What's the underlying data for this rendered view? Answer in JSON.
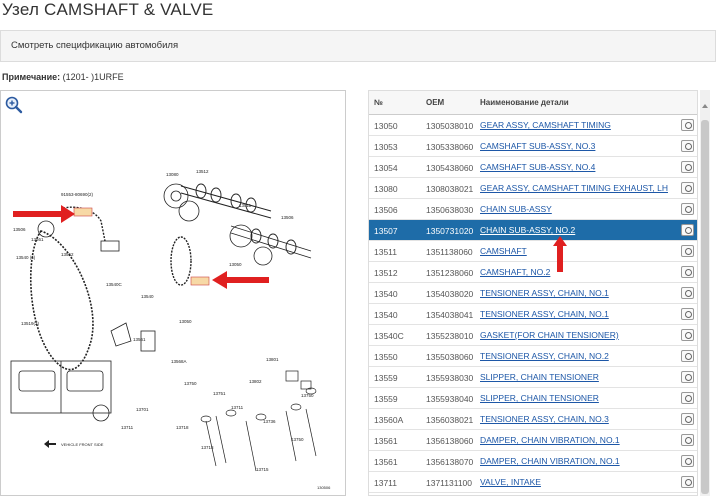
{
  "page": {
    "title": "Узел CAMSHAFT & VALVE"
  },
  "spec_bar": {
    "label": "Смотреть спецификацию автомобиля"
  },
  "note": {
    "label": "Примечание:",
    "value": "(1201- )1URFE"
  },
  "diagram": {
    "callouts": [
      "13523",
      "13521",
      "13540",
      "13506",
      "13561",
      "13050",
      "13053",
      "13054",
      "13080",
      "13507",
      "13508",
      "13509",
      "13559",
      "13565",
      "13566",
      "13511",
      "13512",
      "13750",
      "13751",
      "13711",
      "13715",
      "13731",
      "13736",
      "13701",
      "13802",
      "13801",
      "13560A"
    ],
    "footer_code": "130506"
  },
  "table": {
    "headers": {
      "num": "№",
      "oem": "OEM",
      "name": "Наименование детали"
    },
    "rows": [
      {
        "num": "13050",
        "oem": "1305038010",
        "name": "GEAR ASSY, CAMSHAFT TIMING",
        "selected": false
      },
      {
        "num": "13053",
        "oem": "1305338060",
        "name": "CAMSHAFT SUB-ASSY, NO.3",
        "selected": false
      },
      {
        "num": "13054",
        "oem": "1305438060",
        "name": "CAMSHAFT SUB-ASSY, NO.4",
        "selected": false
      },
      {
        "num": "13080",
        "oem": "1308038021",
        "name": "GEAR ASSY, CAMSHAFT TIMING EXHAUST, LH",
        "selected": false
      },
      {
        "num": "13506",
        "oem": "1350638030",
        "name": "CHAIN SUB-ASSY",
        "selected": false
      },
      {
        "num": "13507",
        "oem": "1350731020",
        "name": "CHAIN SUB-ASSY, NO.2",
        "selected": true
      },
      {
        "num": "13511",
        "oem": "1351138060",
        "name": "CAMSHAFT",
        "selected": false
      },
      {
        "num": "13512",
        "oem": "1351238060",
        "name": "CAMSHAFT, NO.2",
        "selected": false
      },
      {
        "num": "13540",
        "oem": "1354038020",
        "name": "TENSIONER ASSY, CHAIN, NO.1",
        "selected": false
      },
      {
        "num": "13540",
        "oem": "1354038041",
        "name": "TENSIONER ASSY, CHAIN, NO.1",
        "selected": false
      },
      {
        "num": "13540C",
        "oem": "1355238010",
        "name": "GASKET(FOR CHAIN TENSIONER)",
        "selected": false
      },
      {
        "num": "13550",
        "oem": "1355038060",
        "name": "TENSIONER ASSY, CHAIN, NO.2",
        "selected": false
      },
      {
        "num": "13559",
        "oem": "1355938030",
        "name": "SLIPPER, CHAIN TENSIONER",
        "selected": false
      },
      {
        "num": "13559",
        "oem": "1355938040",
        "name": "SLIPPER, CHAIN TENSIONER",
        "selected": false
      },
      {
        "num": "13560A",
        "oem": "1356038021",
        "name": "TENSIONER ASSY, CHAIN, NO.3",
        "selected": false
      },
      {
        "num": "13561",
        "oem": "1356138060",
        "name": "DAMPER, CHAIN VIBRATION, NO.1",
        "selected": false
      },
      {
        "num": "13561",
        "oem": "1356138070",
        "name": "DAMPER, CHAIN VIBRATION, NO.1",
        "selected": false
      },
      {
        "num": "13711",
        "oem": "1371131100",
        "name": "VALVE, INTAKE",
        "selected": false
      }
    ]
  },
  "colors": {
    "selected_row": "#1e6ca8",
    "link": "#1d57a7",
    "arrow": "#e02020"
  }
}
